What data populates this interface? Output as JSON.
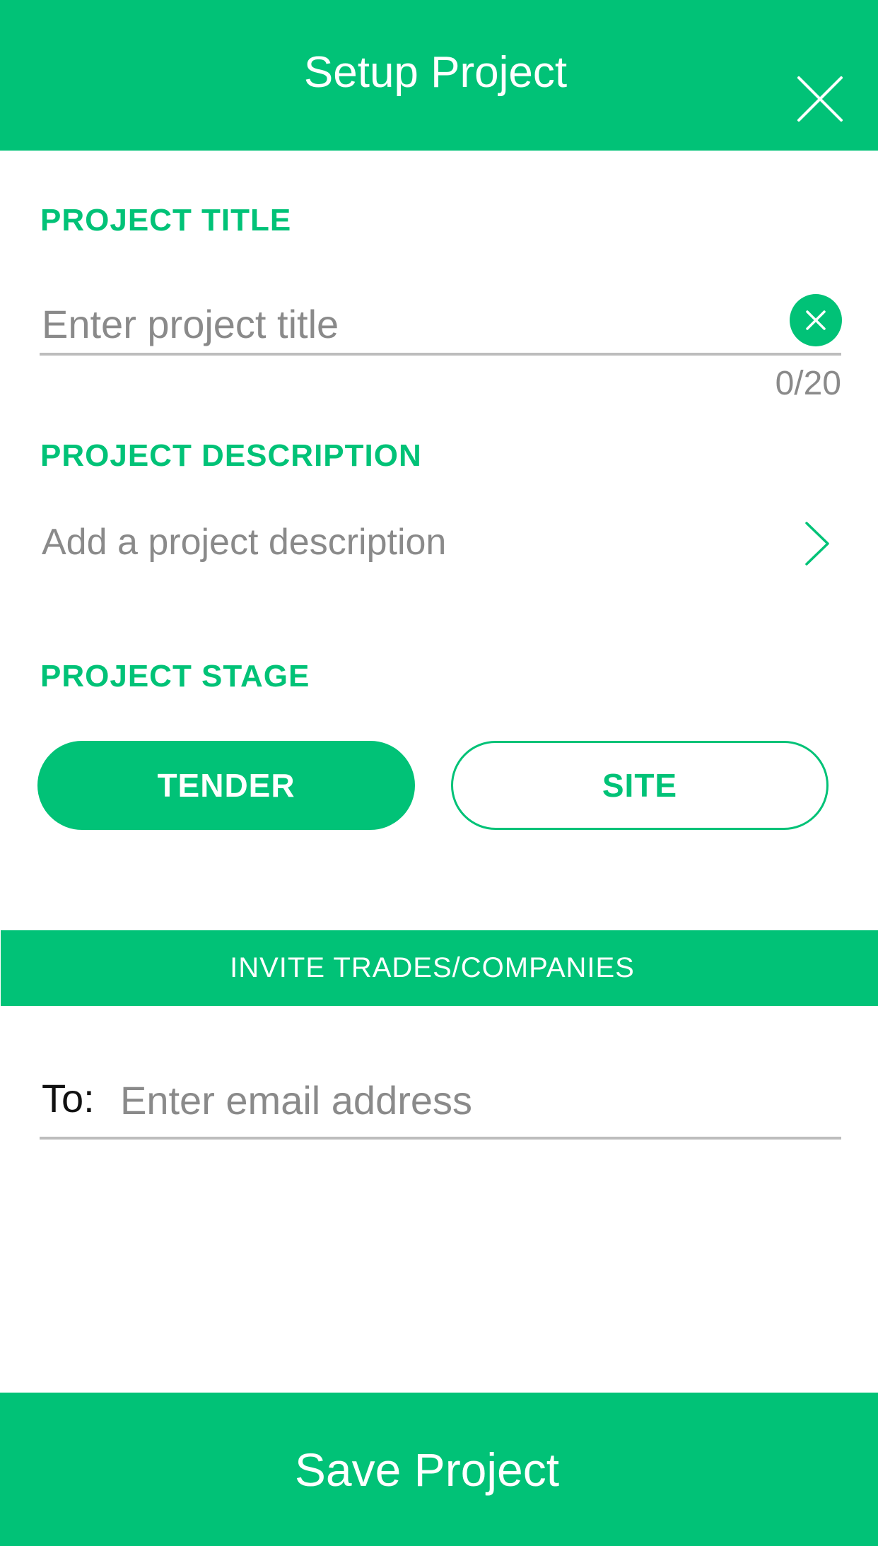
{
  "header": {
    "title": "Setup Project",
    "close_icon": "close-icon"
  },
  "project_title": {
    "label": "PROJECT TITLE",
    "placeholder": "Enter project title",
    "value": "",
    "counter": "0/20",
    "clear_icon": "clear-icon"
  },
  "project_description": {
    "label": "PROJECT DESCRIPTION",
    "placeholder_text": "Add a project description",
    "chevron_icon": "chevron-right-icon"
  },
  "project_stage": {
    "label": "PROJECT STAGE",
    "options": [
      {
        "label": "TENDER",
        "selected": true
      },
      {
        "label": "SITE",
        "selected": false
      }
    ]
  },
  "invite": {
    "bar_label": "INVITE TRADES/COMPANIES",
    "to_label": "To:",
    "email_placeholder": "Enter email address",
    "email_value": ""
  },
  "footer": {
    "save_label": "Save Project"
  },
  "colors": {
    "accent": "#01c277",
    "placeholder": "#8a8a8a",
    "divider": "#bdbdbd",
    "background": "#ffffff"
  }
}
